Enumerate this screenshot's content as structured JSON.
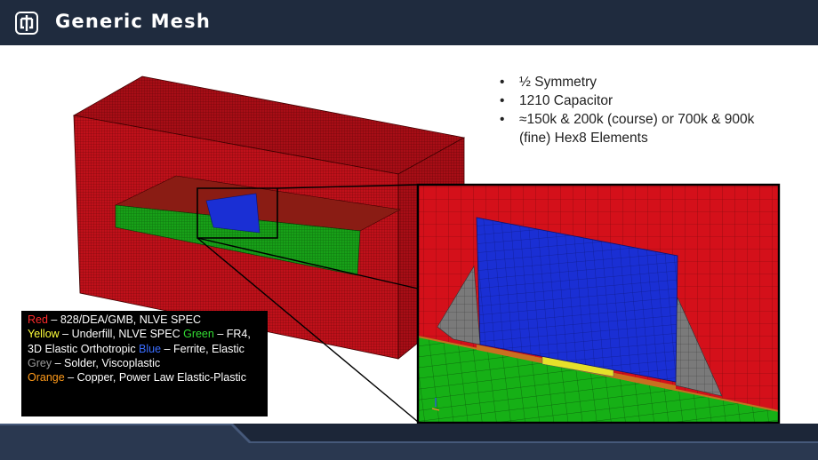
{
  "header": {
    "title": "Generic Mesh",
    "logo_icon": "sandia-thunderbird-logo"
  },
  "bullets": [
    "½ Symmetry",
    "1210 Capacitor",
    "≈150k & 200k (course) or 700k & 900k (fine) Hex8 Elements"
  ],
  "legend": {
    "red_label": "Red",
    "red_text": " – 828/DEA/GMB, NLVE SPEC",
    "yellow_label": "Yellow",
    "yellow_text": " – Underfill, NLVE SPEC ",
    "green_label": "Green",
    "green_text": " – FR4, 3D Elastic Orthotropic ",
    "blue_label": "Blue",
    "blue_text": " – Ferrite, Elastic",
    "grey_label": "Grey",
    "grey_text": " – Solder, Viscoplastic",
    "orange_label": "Orange",
    "orange_text": " – Copper, Power Law Elastic-Plastic"
  },
  "colors": {
    "header_bg": "#1f2b3e",
    "mesh_red": "#c0101a",
    "mesh_green": "#18b018",
    "mesh_blue": "#1a2fd4",
    "mesh_grey": "#7a7a7a",
    "mesh_yellow": "#e6e02a",
    "mesh_orange": "#c87020"
  }
}
